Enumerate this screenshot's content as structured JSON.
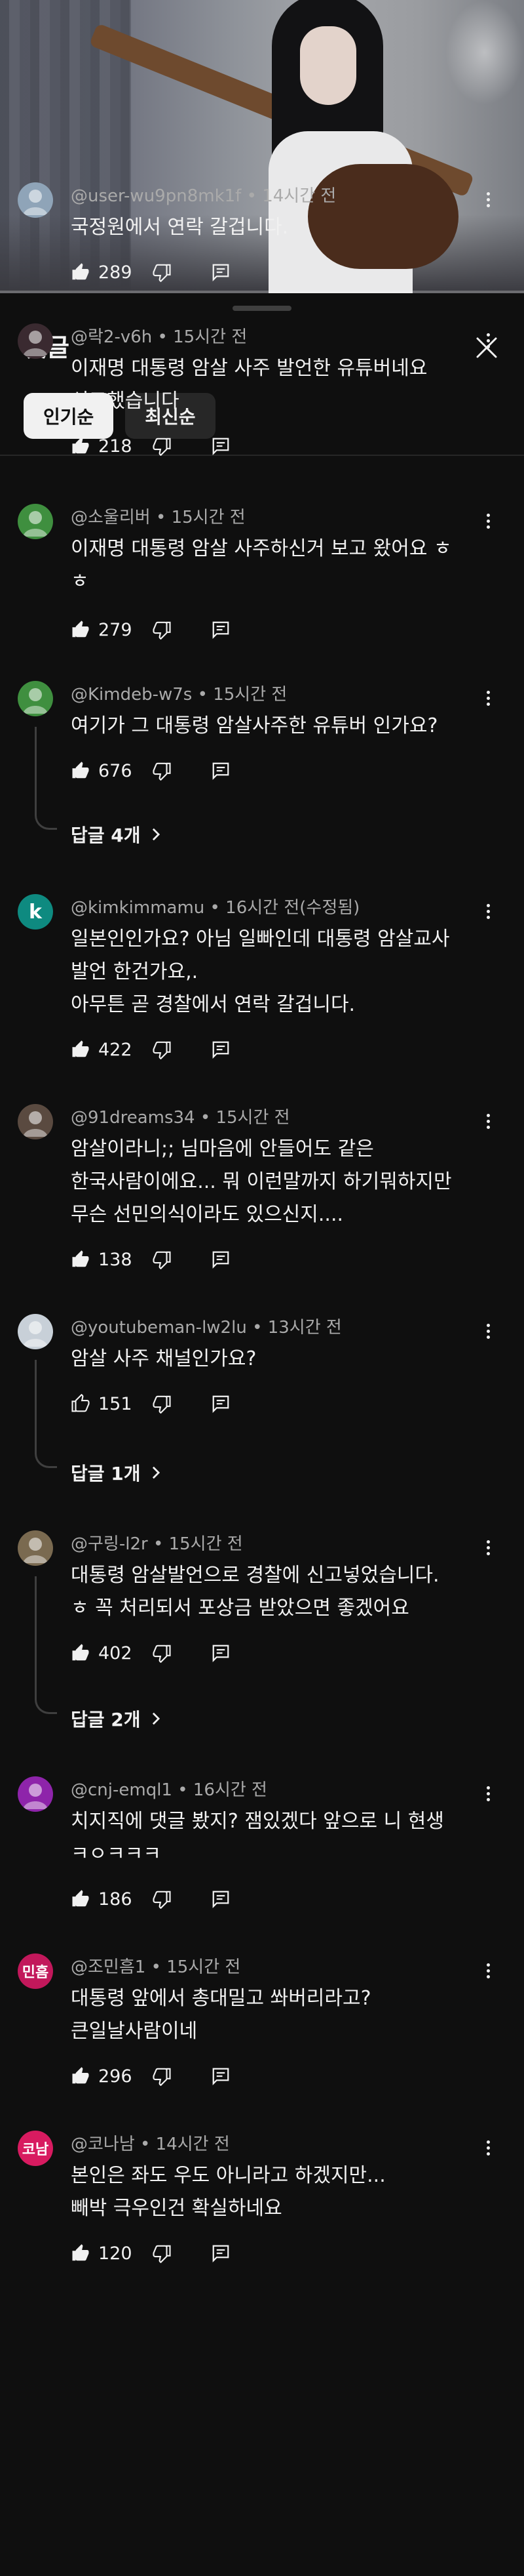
{
  "sheet": {
    "title": "댓글",
    "chips": [
      "인기순",
      "최신순"
    ]
  },
  "comments": [
    {
      "author": "@user-wu9pn8mk1f",
      "time": "14시간 전",
      "text": "국정원에서 연락 갈겁니다.",
      "likes": "289",
      "avatar_color": "#8fa4b8"
    },
    {
      "author": "@락2-v6h",
      "time": "15시간 전",
      "text": "이재명 대통령 암살 사주 발언한 유튜버네요\n신고했습니다",
      "likes": "218",
      "avatar_color": "#3a2a30"
    },
    {
      "author": "@소울리버",
      "time": "15시간 전",
      "text": "이재명 대통령 암살 사주하신거 보고 왔어요 ㅎ\nㅎ",
      "likes": "279",
      "avatar_color": "#3f8f3f"
    },
    {
      "author": "@Kimdeb-w7s",
      "time": "15시간 전",
      "text": "여기가 그 대통령 암살사주한 유튜버 인가요?",
      "likes": "676",
      "avatar_color": "#3f8f3f",
      "replies": "답글 4개"
    },
    {
      "author": "@kimkimmamu",
      "time": "16시간 전(수정됨)",
      "text": "일본인인가요? 아님 일빠인데 대통령 암살교사\n발언 한건가요,.\n아무튼 곧 경찰에서 연락 갈겁니다.",
      "likes": "422",
      "avatar_color": "#0e8a80",
      "avatar_letter": "k"
    },
    {
      "author": "@91dreams34",
      "time": "15시간 전",
      "text": "암살이라니;; 님마음에 안들어도 같은\n한국사람이에요... 뭐 이런말까지 하기뭐하지만\n무슨 선민의식이라도 있으신지....",
      "likes": "138",
      "avatar_color": "#5a4a40"
    },
    {
      "author": "@youtubeman-lw2lu",
      "time": "13시간 전",
      "text": "암살 사주 채널인가요?",
      "likes": "151",
      "avatar_color": "#c8d0d8",
      "replies": "답글 1개"
    },
    {
      "author": "@구링-l2r",
      "time": "15시간 전",
      "text": "대통령 암살발언으로 경찰에 신고넣었습니다.\nㅎ 꼭 처리되서 포상금 받았으면 좋겠어요",
      "likes": "402",
      "avatar_color": "#7a6a50",
      "replies": "답글 2개"
    },
    {
      "author": "@cnj-emql1",
      "time": "16시간 전",
      "text": "치지직에 댓글 봤지?  잼있겠다 앞으로 니 현생\nㅋㅇㅋㅋㅋ",
      "likes": "186",
      "avatar_color": "#8e24aa"
    },
    {
      "author": "@조민흠1",
      "time": "15시간 전",
      "text": "대통령 앞에서 총대밀고 쏴버리라고?\n큰일날사람이네",
      "likes": "296",
      "avatar_color": "#c2185b",
      "avatar_letter": "민흠"
    },
    {
      "author": "@코나남",
      "time": "14시간 전",
      "text": "본인은 좌도 우도 아니라고 하겠지만...\n빼박 극우인건 확실하네요",
      "likes": "120",
      "avatar_color": "#d81b60",
      "avatar_letter": "코남"
    }
  ],
  "colors": {
    "background": "#0f0f0f",
    "text": "#f1f1f1",
    "meta": "#aaaaaa",
    "chip_active": "#f1f1f1",
    "chip_inactive": "#272727"
  }
}
